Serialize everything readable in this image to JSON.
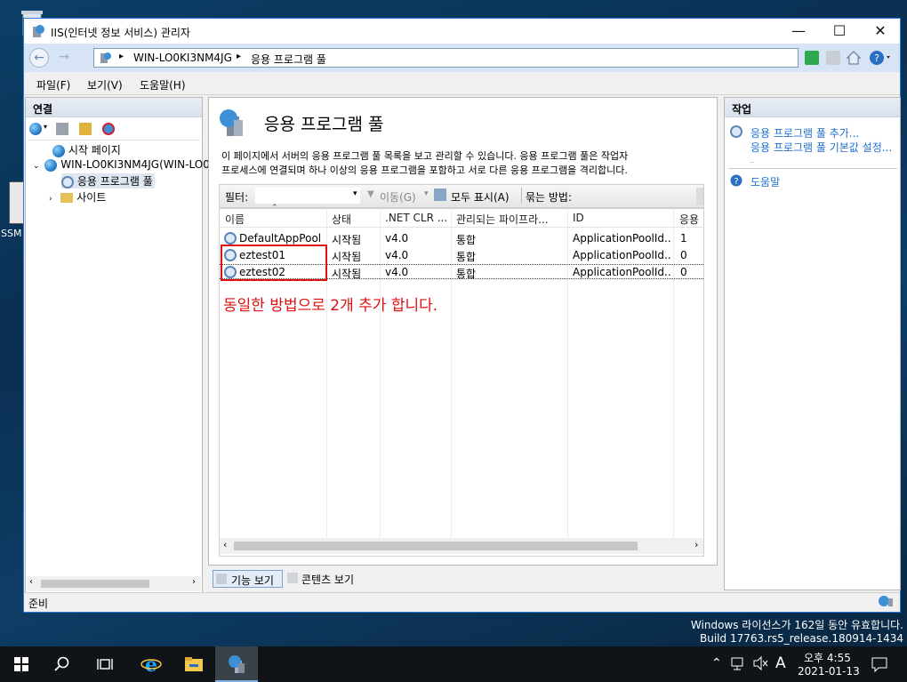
{
  "window": {
    "title": "IIS(인터넷 정보 서비스) 관리자",
    "controls": {
      "minimize": "—",
      "maximize": "☐",
      "close": "✕"
    }
  },
  "address": {
    "back": "←",
    "forward": "→",
    "crumbs": [
      "WIN-LO0KI3NM4JG",
      "응용 프로그램 풀"
    ],
    "sep": "▸"
  },
  "menu": [
    "파일(F)",
    "보기(V)",
    "도움말(H)"
  ],
  "connections": {
    "title": "연결",
    "tree": [
      {
        "label": "시작 페이지"
      },
      {
        "label": "WIN-LO0KI3NM4JG(WIN-LO0"
      },
      {
        "label": "응용 프로그램 풀"
      },
      {
        "label": "사이트"
      }
    ]
  },
  "main": {
    "heading": "응용 프로그램 풀",
    "description_line1": "이 페이지에서 서버의 응용 프로그램 풀 목록을 보고 관리할 수 있습니다. 응용 프로그램 풀은 작업자",
    "description_line2": "프로세스에 연결되며 하나 이상의 응용 프로그램을 포함하고 서로 다른 응용 프로그램을 격리합니다.",
    "filter_label": "필터:",
    "go_label": "이동(G)",
    "show_all_label": "모두 표시(A)",
    "group_by_label": "묶는 방법:",
    "columns": [
      "이름",
      "상태",
      ".NET CLR ...",
      "관리되는 파이프라...",
      "ID",
      "응용"
    ],
    "rows": [
      {
        "name": "DefaultAppPool",
        "status": "시작됨",
        "clr": "v4.0",
        "pipeline": "통합",
        "identity": "ApplicationPoolId...",
        "apps": "1"
      },
      {
        "name": "eztest01",
        "status": "시작됨",
        "clr": "v4.0",
        "pipeline": "통합",
        "identity": "ApplicationPoolId...",
        "apps": "0"
      },
      {
        "name": "eztest02",
        "status": "시작됨",
        "clr": "v4.0",
        "pipeline": "통합",
        "identity": "ApplicationPoolId...",
        "apps": "0"
      }
    ],
    "annotation": "동일한 방법으로 2개 추가 합니다.",
    "view_tabs": [
      "기능 보기",
      "콘텐츠 보기"
    ]
  },
  "actions": {
    "title": "작업",
    "items": [
      "응용 프로그램 풀 추가...",
      "응용 프로그램 풀 기본값 설정...",
      "도움말"
    ]
  },
  "status": {
    "text": "준비"
  },
  "desktop": {
    "watermark_line1": "Windows 라이선스가 162일 동안 유효합니다.",
    "watermark_line2": "Build 17763.rs5_release.180914-1434",
    "label_left": "SSM"
  },
  "tray": {
    "time": "오후 4:55",
    "date": "2021-01-13",
    "ime": "A"
  },
  "colors": {
    "annotation": "#e01010",
    "link": "#1f6fcf",
    "titlebar_border": "#2b7bd2"
  }
}
